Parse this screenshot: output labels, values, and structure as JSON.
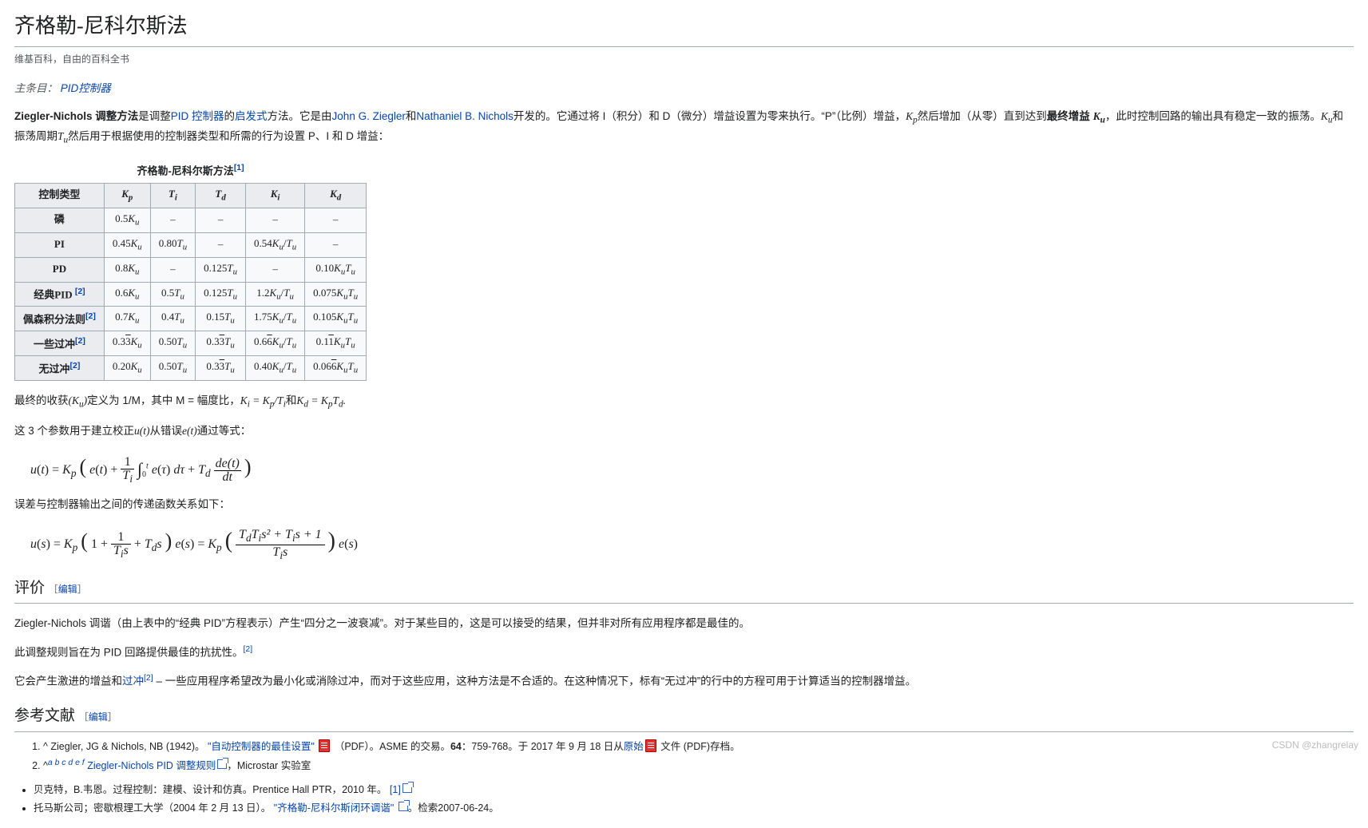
{
  "title": "齐格勒-尼科尔斯法",
  "subtitle": "维基百科，自由的百科全书",
  "hatnote": {
    "prefix": "主条目：",
    "link": "PID控制器"
  },
  "intro": {
    "strong": "Ziegler-Nichols 调整方法",
    "t1": "是调整",
    "link1": "PID 控制器",
    "t2": "的",
    "link2": "启发式",
    "t3": "方法。它是由",
    "link3": "John G. Ziegler",
    "t_and": "和",
    "link4": "Nathaniel B. Nichols",
    "t4": "开发的。它通过将 I（积分）和 D（微分）增益设置为零来执行。“P”（比例）增益，",
    "kp": "K_p",
    "t5": "然后增加（从零）直到达到",
    "strong2": "最终增益 ",
    "ku": "K_u",
    "t6": "，此时控制回路的输出具有稳定一致的振荡。",
    "ku2": "K_u",
    "t7": "和振荡周期",
    "tu": "T_u",
    "t8": "然后用于根据使用的控制器类型和所需的行为设置 P、I 和 D 增益："
  },
  "table": {
    "caption": "齐格勒-尼科尔斯方法",
    "cap_ref": "[1]",
    "headers": [
      "控制类型",
      "K_p",
      "T_i",
      "T_d",
      "K_i",
      "K_d"
    ],
    "rows": [
      {
        "label": "磷",
        "ref": "",
        "cells": [
          "0.5K_u",
          "–",
          "–",
          "–",
          "–"
        ]
      },
      {
        "label": "PI",
        "ref": "",
        "cells": [
          "0.45K_u",
          "0.80T_u",
          "–",
          "0.54K_u/T_u",
          "–"
        ]
      },
      {
        "label": "PD",
        "ref": "",
        "cells": [
          "0.8K_u",
          "–",
          "0.125T_u",
          "–",
          "0.10K_uT_u"
        ]
      },
      {
        "label": "经典PID ",
        "ref": "[2]",
        "cells": [
          "0.6K_u",
          "0.5T_u",
          "0.125T_u",
          "1.2K_u/T_u",
          "0.075K_uT_u"
        ]
      },
      {
        "label": "佩森积分法则",
        "ref": "[2]",
        "cells": [
          "0.7K_u",
          "0.4T_u",
          "0.15T_u",
          "1.75K_u/T_u",
          "0.105K_uT_u"
        ]
      },
      {
        "label": "一些过冲",
        "ref": "[2]",
        "cells": [
          "0.3̅3K_u",
          "0.50T_u",
          "0.3̅3T_u",
          "0.6̅6K_u/T_u",
          "0.1̅1K_uT_u"
        ]
      },
      {
        "label": "无过冲",
        "ref": "[2]",
        "cells": [
          "0.20K_u",
          "0.50T_u",
          "0.3̅3T_u",
          "0.40K_u/T_u",
          "0.06̅6K_uT_u"
        ]
      }
    ]
  },
  "para_after_table": {
    "t1": "最终的收获",
    "ku": "(K_u)",
    "t2": "定义为 1/M，其中 M = 幅度比，",
    "eq1": "K_i = K_p/T_i",
    "and": "和",
    "eq2": "K_d = K_pT_d.",
    "p2_a": "这 3 个参数用于建立校正",
    "ut": "u(t)",
    "p2_b": "从错误",
    "et": "e(t)",
    "p2_c": "通过等式："
  },
  "equation1": "u(t) = K_p ( e(t) + (1/T_i) ∫₀ᵗ e(τ) dτ + T_d · de(t)/dt )",
  "para_tf": "误差与控制器输出之间的传递函数关系如下：",
  "equation2": "u(s) = K_p ( 1 + 1/(T_i s) + T_d s ) e(s) = K_p ( (T_dT_i s² + T_i s + 1) / (T_i s) ) e(s)",
  "eval": {
    "heading": "评价",
    "edit": "编辑",
    "p1": "Ziegler-Nichols 调谐（由上表中的“经典 PID”方程表示）产生“四分之一波衰减”。对于某些目的，这是可以接受的结果，但并非对所有应用程序都是最佳的。",
    "p2a": "此调整规则旨在为 PID 回路提供最佳的抗扰性。",
    "p2_ref": "[2]",
    "p3a": "它会产生激进的增益和",
    "p3_link": "过冲",
    "p3_ref": "[2]",
    "p3b": " – 一些应用程序希望改为最小化或消除过冲，而对于这些应用，这种方法是不合适的。在这种情况下，标有“无过冲”的行中的方程可用于计算适当的控制器增益。"
  },
  "refs": {
    "heading": "参考文献",
    "edit": "编辑",
    "items": [
      {
        "marker": "^",
        "body_a": "Ziegler, JG & Nichols, NB (1942)。",
        "link": "\"自动控制器的最佳设置\"",
        "pdf": true,
        "body_b": "（PDF）。ASME 的交易。",
        "bold": "64",
        "body_c": "：759-768。于 2017 年 9 月 18 日从",
        "link2": "原始",
        "body_d": "文件 (PDF)存档。"
      },
      {
        "marker": "^",
        "sup": "a b c d e f",
        "link": "Ziegler-Nichols PID 调整规则",
        "ext": true,
        "body_b": "，Microstar 实验室"
      }
    ],
    "biblio": [
      {
        "text_a": "贝克特，B.韦恩。过程控制：建模、设计和仿真。Prentice Hall PTR，2010 年。",
        "link": "[1]",
        "ext": true
      },
      {
        "text_a": "托马斯公司；密歇根理工大学（2004 年 2 月 13 日）。",
        "link": "\"齐格勒-尼科尔斯闭环调谐\"",
        "ext": true,
        "text_b": "。检索2007-06-24。"
      }
    ]
  },
  "watermark": "CSDN @zhangrelay"
}
